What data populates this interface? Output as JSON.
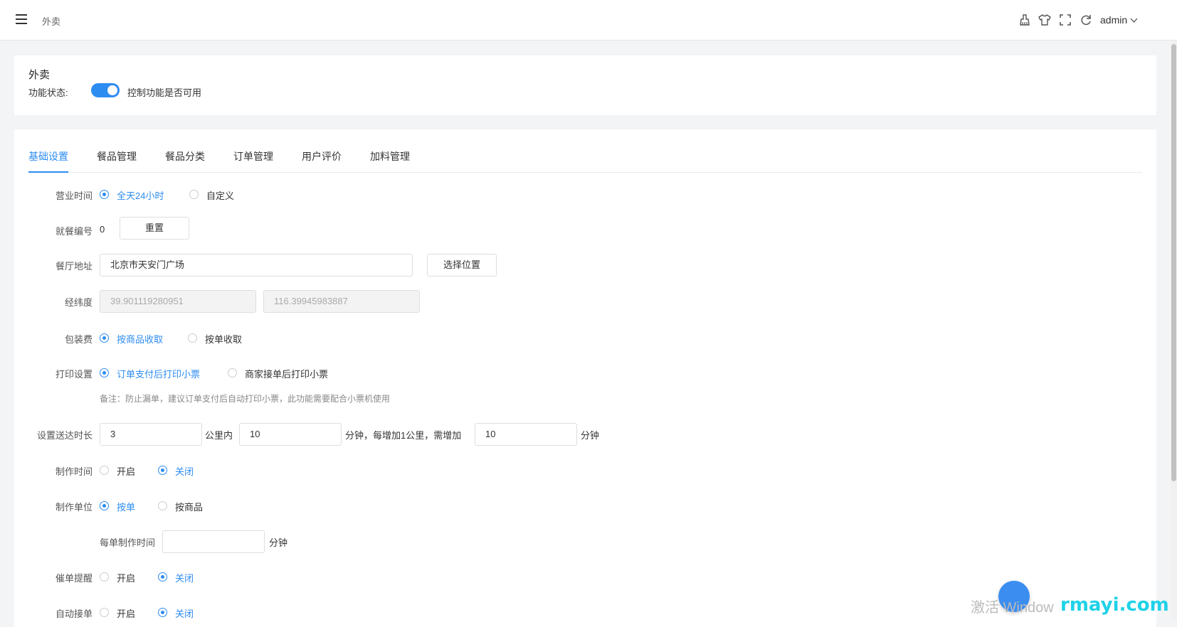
{
  "header": {
    "breadcrumb": "外卖",
    "icons": [
      "clear-cache-icon",
      "theme-shirt-icon",
      "fullscreen-icon",
      "refresh-icon"
    ],
    "username": "admin"
  },
  "feature": {
    "title": "外卖",
    "status_label": "功能状态:",
    "status_on": true,
    "status_desc": "控制功能是否可用"
  },
  "tabs": [
    {
      "label": "基础设置",
      "active": true
    },
    {
      "label": "餐品管理",
      "active": false
    },
    {
      "label": "餐品分类",
      "active": false
    },
    {
      "label": "订单管理",
      "active": false
    },
    {
      "label": "用户评价",
      "active": false
    },
    {
      "label": "加料管理",
      "active": false
    }
  ],
  "form": {
    "business_hours": {
      "label": "营业时间",
      "options": [
        "全天24小时",
        "自定义"
      ],
      "selected": 0
    },
    "meal_number": {
      "label": "就餐编号",
      "value": "0",
      "reset_label": "重置"
    },
    "address": {
      "label": "餐厅地址",
      "value": "北京市天安门广场",
      "choose_label": "选择位置"
    },
    "coords": {
      "label": "经纬度",
      "lat": "39.901119280951",
      "lng": "116.39945983887"
    },
    "packing_fee": {
      "label": "包装费",
      "options": [
        "按商品收取",
        "按单收取"
      ],
      "selected": 0
    },
    "print": {
      "label": "打印设置",
      "options": [
        "订单支付后打印小票",
        "商家接单后打印小票"
      ],
      "selected": 0,
      "note": "备注：防止漏单，建议订单支付后自动打印小票，此功能需要配合小票机使用"
    },
    "delivery": {
      "label": "设置送达时长",
      "base_value": "3",
      "unit1": "公里内",
      "base_minutes": "10",
      "mid_text": "分钟，每增加1公里，需增加",
      "extra_minutes": "10",
      "unit2": "分钟"
    },
    "make_time": {
      "label": "制作时间",
      "options": [
        "开启",
        "关闭"
      ],
      "selected": 1
    },
    "make_unit": {
      "label": "制作单位",
      "options": [
        "按单",
        "按商品"
      ],
      "selected": 0
    },
    "per_order_time": {
      "label": "每单制作时间",
      "value": "",
      "unit": "分钟"
    },
    "reminder": {
      "label": "催单提醒",
      "options": [
        "开启",
        "关闭"
      ],
      "selected": 1
    },
    "auto_accept": {
      "label": "自动接单",
      "options": [
        "开启",
        "关闭"
      ],
      "selected": 1
    }
  },
  "watermark": {
    "text": "激活 Window",
    "brand": "rmayi.com"
  }
}
